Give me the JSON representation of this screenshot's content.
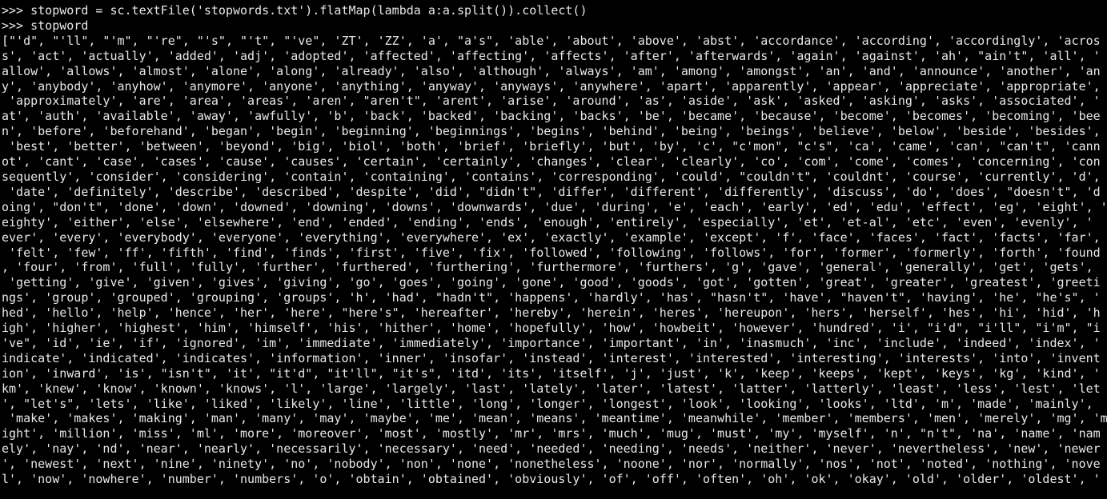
{
  "terminal": {
    "app": "pyspark-shell",
    "background_color": "#000000",
    "foreground_color": "#e8e8e8",
    "prompt": ">>> ",
    "font_size_px": 15,
    "columns": 172,
    "rows": 33,
    "lines": [
      {
        "type": "prompt",
        "text": ">>> stopword = sc.textFile('stopwords.txt').flatMap(lambda a:a.split()).collect()"
      },
      {
        "type": "prompt",
        "text": ">>> stopword"
      },
      {
        "type": "output",
        "text": "[\"'d\", \"'ll\", \"'m\", \"'re\", \"'s\", \"'t\", \"'ve\", 'ZT', 'ZZ', 'a', \"a's\", 'able', 'about', 'above', 'abst', 'accordance', 'according', 'accordingly', 'acros"
      },
      {
        "type": "output",
        "text": "s', 'act', 'actually', 'added', 'adj', 'adopted', 'affected', 'affecting', 'affects', 'after', 'afterwards', 'again', 'against', 'ah', \"ain't\", 'all', '"
      },
      {
        "type": "output",
        "text": "allow', 'allows', 'almost', 'alone', 'along', 'already', 'also', 'although', 'always', 'am', 'among', 'amongst', 'an', 'and', 'announce', 'another', 'an"
      },
      {
        "type": "output",
        "text": "y', 'anybody', 'anyhow', 'anymore', 'anyone', 'anything', 'anyway', 'anyways', 'anywhere', 'apart', 'apparently', 'appear', 'appreciate', 'appropriate',"
      },
      {
        "type": "output",
        "text": " 'approximately', 'are', 'area', 'areas', 'aren', \"aren't\", 'arent', 'arise', 'around', 'as', 'aside', 'ask', 'asked', 'asking', 'asks', 'associated', '"
      },
      {
        "type": "output",
        "text": "at', 'auth', 'available', 'away', 'awfully', 'b', 'back', 'backed', 'backing', 'backs', 'be', 'became', 'because', 'become', 'becomes', 'becoming', 'bee"
      },
      {
        "type": "output",
        "text": "n', 'before', 'beforehand', 'began', 'begin', 'beginning', 'beginnings', 'begins', 'behind', 'being', 'beings', 'believe', 'below', 'beside', 'besides',"
      },
      {
        "type": "output",
        "text": " 'best', 'better', 'between', 'beyond', 'big', 'biol', 'both', 'brief', 'briefly', 'but', 'by', 'c', \"c'mon\", \"c's\", 'ca', 'came', 'can', \"can't\", 'cann"
      },
      {
        "type": "output",
        "text": "ot', 'cant', 'case', 'cases', 'cause', 'causes', 'certain', 'certainly', 'changes', 'clear', 'clearly', 'co', 'com', 'come', 'comes', 'concerning', 'con"
      },
      {
        "type": "output",
        "text": "sequently', 'consider', 'considering', 'contain', 'containing', 'contains', 'corresponding', 'could', \"couldn't\", 'couldnt', 'course', 'currently', 'd',"
      },
      {
        "type": "output",
        "text": " 'date', 'definitely', 'describe', 'described', 'despite', 'did', \"didn't\", 'differ', 'different', 'differently', 'discuss', 'do', 'does', \"doesn't\", 'd"
      },
      {
        "type": "output",
        "text": "oing', \"don't\", 'done', 'down', 'downed', 'downing', 'downs', 'downwards', 'due', 'during', 'e', 'each', 'early', 'ed', 'edu', 'effect', 'eg', 'eight', '"
      },
      {
        "type": "output",
        "text": "eighty', 'either', 'else', 'elsewhere', 'end', 'ended', 'ending', 'ends', 'enough', 'entirely', 'especially', 'et', 'et-al', 'etc', 'even', 'evenly', '"
      },
      {
        "type": "output",
        "text": "ever', 'every', 'everybody', 'everyone', 'everything', 'everywhere', 'ex', 'exactly', 'example', 'except', 'f', 'face', 'faces', 'fact', 'facts', 'far',"
      },
      {
        "type": "output",
        "text": " 'felt', 'few', 'ff', 'fifth', 'find', 'finds', 'first', 'five', 'fix', 'followed', 'following', 'follows', 'for', 'former', 'formerly', 'forth', 'found"
      },
      {
        "type": "output",
        "text": ", 'four', 'from', 'full', 'fully', 'further', 'furthered', 'furthering', 'furthermore', 'furthers', 'g', 'gave', 'general', 'generally', 'get', 'gets',"
      },
      {
        "type": "output",
        "text": " 'getting', 'give', 'given', 'gives', 'giving', 'go', 'goes', 'going', 'gone', 'good', 'goods', 'got', 'gotten', 'great', 'greater', 'greatest', 'greeti"
      },
      {
        "type": "output",
        "text": "ngs', 'group', 'grouped', 'grouping', 'groups', 'h', 'had', \"hadn't\", 'happens', 'hardly', 'has', \"hasn't\", 'have', \"haven't\", 'having', 'he', \"he's\", '"
      },
      {
        "type": "output",
        "text": "hed', 'hello', 'help', 'hence', 'her', 'here', \"here's\", 'hereafter', 'hereby', 'herein', 'heres', 'hereupon', 'hers', 'herself', 'hes', 'hi', 'hid', 'h"
      },
      {
        "type": "output",
        "text": "igh', 'higher', 'highest', 'him', 'himself', 'his', 'hither', 'home', 'hopefully', 'how', 'howbeit', 'however', 'hundred', 'i', \"i'd\", \"i'll\", \"i'm\", \"i"
      },
      {
        "type": "output",
        "text": "'ve\", 'id', 'ie', 'if', 'ignored', 'im', 'immediate', 'immediately', 'importance', 'important', 'in', 'inasmuch', 'inc', 'include', 'indeed', 'index', '"
      },
      {
        "type": "output",
        "text": "indicate', 'indicated', 'indicates', 'information', 'inner', 'insofar', 'instead', 'interest', 'interested', 'interesting', 'interests', 'into', 'invent"
      },
      {
        "type": "output",
        "text": "ion', 'inward', 'is', \"isn't\", 'it', \"it'd\", \"it'll\", \"it's\", 'itd', 'its', 'itself', 'j', 'just', 'k', 'keep', 'keeps', 'kept', 'keys', 'kg', 'kind', '"
      },
      {
        "type": "output",
        "text": "km', 'knew', 'know', 'known', 'knows', 'l', 'large', 'largely', 'last', 'lately', 'later', 'latest', 'latter', 'latterly', 'least', 'less', 'lest', 'let"
      },
      {
        "type": "output",
        "text": "', \"let's\", 'lets', 'like', 'liked', 'likely', 'line', 'little', 'long', 'longer', 'longest', 'look', 'looking', 'looks', 'ltd', 'm', 'made', 'mainly',"
      },
      {
        "type": "output",
        "text": " 'make', 'makes', 'making', 'man', 'many', 'may', 'maybe', 'me', 'mean', 'means', 'meantime', 'meanwhile', 'member', 'members', 'men', 'merely', 'mg', 'm"
      },
      {
        "type": "output",
        "text": "ight', 'million', 'miss', 'ml', 'more', 'moreover', 'most', 'mostly', 'mr', 'mrs', 'much', 'mug', 'must', 'my', 'myself', 'n', \"n't\", 'na', 'name', 'nam"
      },
      {
        "type": "output",
        "text": "ely', 'nay', 'nd', 'near', 'nearly', 'necessarily', 'necessary', 'need', 'needed', 'needing', 'needs', 'neither', 'never', 'nevertheless', 'new', 'newer"
      },
      {
        "type": "output",
        "text": "', 'newest', 'next', 'nine', 'ninety', 'no', 'nobody', 'non', 'none', 'nonetheless', 'noone', 'nor', 'normally', 'nos', 'not', 'noted', 'nothing', 'nove"
      },
      {
        "type": "output",
        "text": "l', 'now', 'nowhere', 'number', 'numbers', 'o', 'obtain', 'obtained', 'obviously', 'of', 'off', 'often', 'oh', 'ok', 'okay', 'old', 'older', 'oldest', '"
      }
    ]
  }
}
